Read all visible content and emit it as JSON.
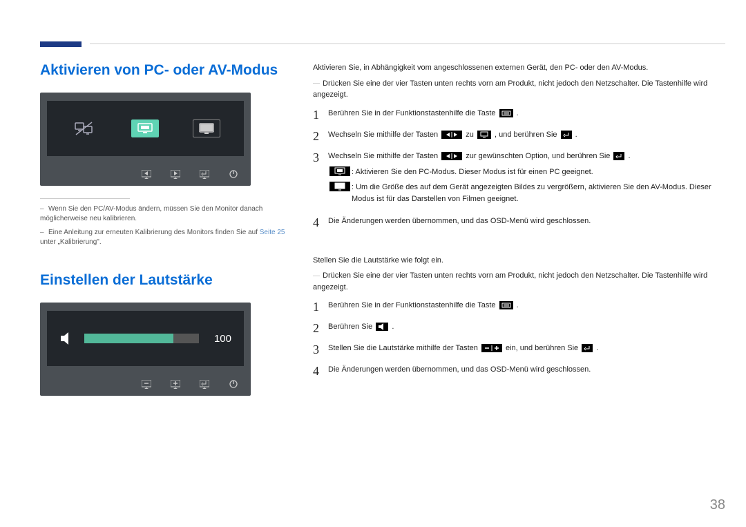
{
  "section1": {
    "heading": "Aktivieren von PC- oder AV-Modus",
    "intro": "Aktivieren Sie, in Abhängigkeit vom angeschlossenen externen Gerät, den PC- oder den AV-Modus.",
    "hint1": "Drücken Sie eine der vier Tasten unten rechts vorn am Produkt, nicht jedoch den Netzschalter. Die Tastenhilfe wird angezeigt.",
    "step1": "Berühren Sie in der Funktionstastenhilfe die Taste ",
    "step2_a": "Wechseln Sie mithilfe der Tasten ",
    "step2_b": " zu ",
    "step2_c": " , und berühren Sie ",
    "step3_a": "Wechseln Sie mithilfe der Tasten ",
    "step3_b": " zur gewünschten Option, und berühren Sie ",
    "step3_sub1": " : Aktivieren Sie den PC-Modus. Dieser Modus ist für einen PC geeignet.",
    "step3_sub2": " : Um die Größe des auf dem Gerät angezeigten Bildes zu vergrößern, aktivieren Sie den AV-Modus. Dieser Modus ist für das Darstellen von Filmen geeignet.",
    "step4": "Die Änderungen werden übernommen, und das OSD-Menü wird geschlossen.",
    "footnote1": "Wenn Sie den PC/AV-Modus ändern, müssen Sie den Monitor danach möglicherweise neu kalibrieren.",
    "footnote2a": "Eine Anleitung zur erneuten Kalibrierung des Monitors finden Sie auf ",
    "footnote2_link": "Seite 25",
    "footnote2b": " unter „Kalibrierung\"."
  },
  "section2": {
    "heading": "Einstellen der Lautstärke",
    "volume": "100",
    "intro": "Stellen Sie die Lautstärke wie folgt ein.",
    "hint1": "Drücken Sie eine der vier Tasten unten rechts vorn am Produkt, nicht jedoch den Netzschalter. Die Tastenhilfe wird angezeigt.",
    "step1": "Berühren Sie in der Funktionstastenhilfe die Taste ",
    "step2": "Berühren Sie ",
    "step3_a": "Stellen Sie die Lautstärke mithilfe der Tasten ",
    "step3_b": " ein, und berühren Sie ",
    "step4": "Die Änderungen werden übernommen, und das OSD-Menü wird geschlossen."
  },
  "pagenum": "38"
}
